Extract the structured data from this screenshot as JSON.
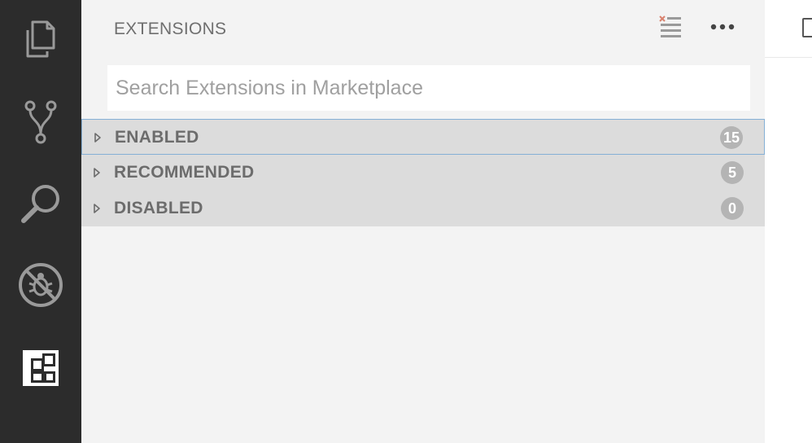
{
  "activity_bar": {
    "items": [
      {
        "icon": "files-icon",
        "active": false
      },
      {
        "icon": "source-control-icon",
        "active": false
      },
      {
        "icon": "search-icon",
        "active": false
      },
      {
        "icon": "debug-icon",
        "active": false
      },
      {
        "icon": "extensions-icon",
        "active": true
      }
    ],
    "background": "#2c2c2c",
    "icon_color": "#9a9a9a",
    "active_icon_color": "#ffffff"
  },
  "sidebar": {
    "title": "EXTENSIONS",
    "actions": [
      {
        "icon": "clear-extensions-icon"
      },
      {
        "icon": "more-actions-icon"
      }
    ],
    "search": {
      "placeholder": "Search Extensions in Marketplace",
      "value": ""
    },
    "sections": [
      {
        "label": "ENABLED",
        "count": "15",
        "expanded": false,
        "focused": true
      },
      {
        "label": "RECOMMENDED",
        "count": "5",
        "expanded": false,
        "focused": false
      },
      {
        "label": "DISABLED",
        "count": "0",
        "expanded": false,
        "focused": false
      }
    ]
  },
  "colors": {
    "sidebar_background": "#f3f3f3",
    "section_header_background": "#dcdcdc",
    "focus_border": "#85b0d6",
    "badge_background": "#b4b4b4",
    "clear_icon_accent": "#d9826e"
  }
}
